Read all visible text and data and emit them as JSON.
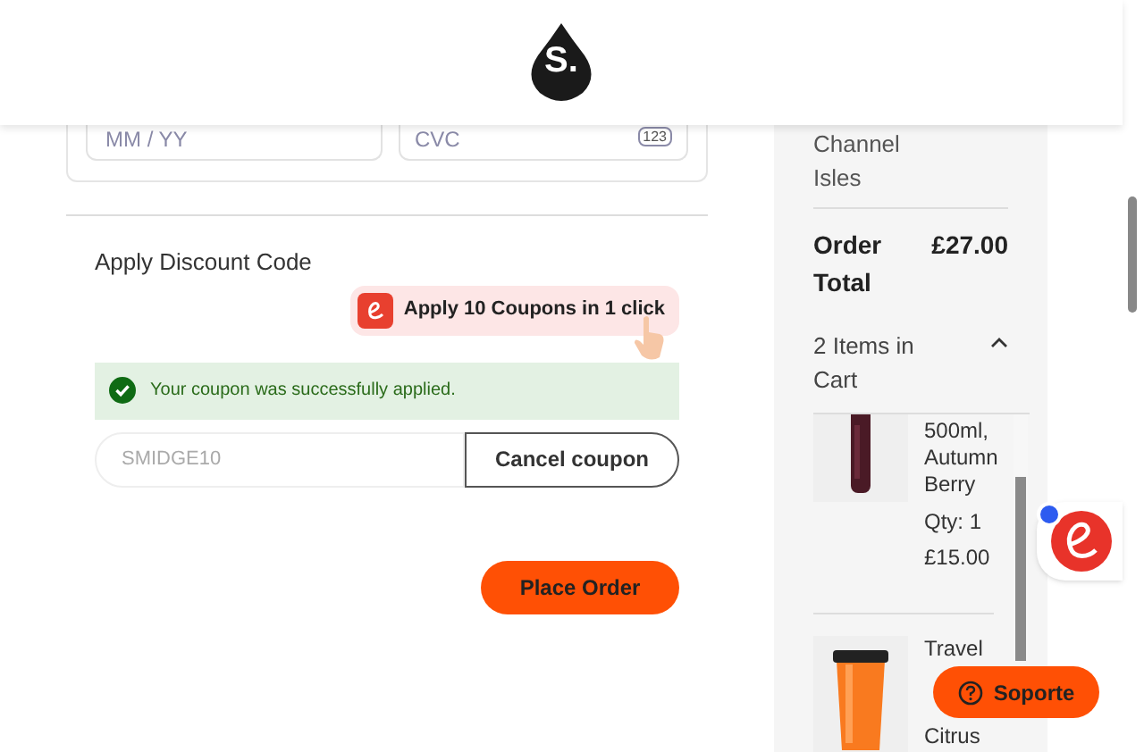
{
  "header": {
    "logo": "S."
  },
  "payment": {
    "expiry_placeholder": "MM / YY",
    "cvc_placeholder": "CVC",
    "cvc_icon_text": "123"
  },
  "discount": {
    "title": "Apply Discount Code",
    "coupon_banner": {
      "text": "Apply **10** Coupons in 1 click"
    },
    "alert": {
      "message": "Your coupon was successfully applied."
    },
    "code_value": "SMIDGE10",
    "cancel_button": "Cancel coupon"
  },
  "place_order": "Place Order",
  "summary": {
    "region": "Channel Isles",
    "total_label": "Order Total",
    "total_value": "£27.00",
    "cart_heading": "2 Items in Cart",
    "expanded": true,
    "items": [
      {
        "kind": "bottle",
        "name_lines": [
          "500ml,",
          "Autumn",
          "Berry"
        ],
        "qty": "Qty: 1",
        "price": "£15.00"
      },
      {
        "kind": "cup",
        "name_lines": [
          "Travel",
          "Citrus"
        ]
      }
    ]
  },
  "support_button": "Soporte"
}
